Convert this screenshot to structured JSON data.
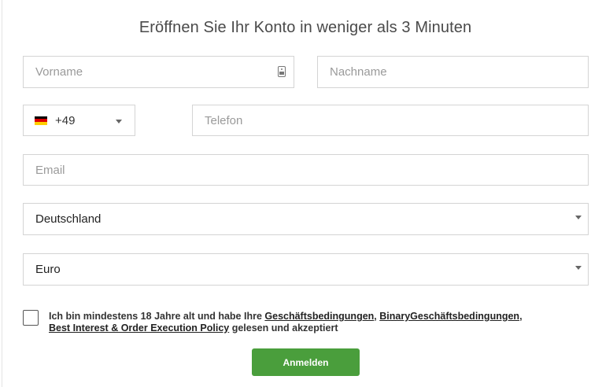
{
  "form": {
    "title": "Eröffnen Sie Ihr Konto in weniger als 3 Minuten",
    "firstname": {
      "placeholder": "Vorname",
      "icon": "contact-card-icon"
    },
    "lastname": {
      "placeholder": "Nachname"
    },
    "phone": {
      "country_code": "+49",
      "flag": "de-flag-icon",
      "placeholder": "Telefon"
    },
    "email": {
      "placeholder": "Email"
    },
    "country": {
      "value": "Deutschland"
    },
    "currency": {
      "value": "Euro"
    },
    "terms": {
      "text_start": "Ich bin mindestens 18 Jahre alt und habe Ihre ",
      "link1": "Geschäftsbedingungen",
      "sep1": ", ",
      "link2": "BinaryGeschäftsbedingungen",
      "sep2": ",",
      "link3": "Best Interest & Order Execution Policy",
      "text_end": " gelesen und akzeptiert",
      "checked": false
    },
    "submit_label": "Anmelden"
  },
  "colors": {
    "accent_green": "#4a9e3c",
    "border": "#d4d4d4",
    "flag": [
      "#000000",
      "#dd0000",
      "#ffce00"
    ]
  }
}
